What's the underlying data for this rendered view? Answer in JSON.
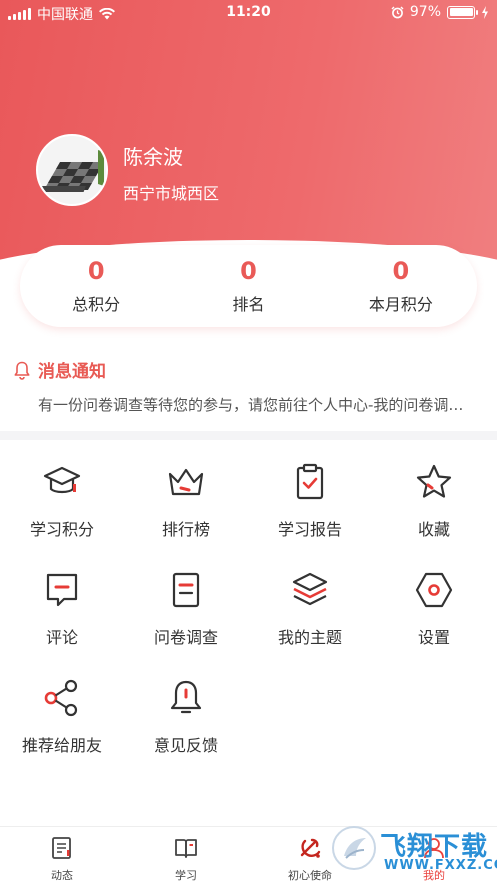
{
  "status_bar": {
    "carrier": "中国联通",
    "time": "11:20",
    "battery": "97%"
  },
  "profile": {
    "name": "陈余波",
    "location": "西宁市城西区"
  },
  "stats": [
    {
      "value": "0",
      "label": "总积分"
    },
    {
      "value": "0",
      "label": "排名"
    },
    {
      "value": "0",
      "label": "本月积分"
    }
  ],
  "notice": {
    "title": "消息通知",
    "text": "有一份问卷调查等待您的参与，请您前往个人中心-我的问卷调查中参与"
  },
  "menu": [
    {
      "label": "学习积分",
      "icon": "graduation-cap-icon"
    },
    {
      "label": "排行榜",
      "icon": "crown-icon"
    },
    {
      "label": "学习报告",
      "icon": "clipboard-check-icon"
    },
    {
      "label": "收藏",
      "icon": "star-icon"
    },
    {
      "label": "评论",
      "icon": "comment-icon"
    },
    {
      "label": "问卷调查",
      "icon": "document-icon"
    },
    {
      "label": "我的主题",
      "icon": "layers-icon"
    },
    {
      "label": "设置",
      "icon": "hexagon-settings-icon"
    },
    {
      "label": "推荐给朋友",
      "icon": "share-icon"
    },
    {
      "label": "意见反馈",
      "icon": "bell-icon"
    }
  ],
  "tabs": [
    {
      "label": "动态",
      "icon": "news-icon"
    },
    {
      "label": "学习",
      "icon": "book-icon"
    },
    {
      "label": "初心使命",
      "icon": "party-emblem-icon"
    },
    {
      "label": "我的",
      "icon": "user-icon",
      "active": true
    }
  ],
  "watermark": {
    "logo": "飞翔下载",
    "url": "WWW.FXXZ.COM"
  },
  "colors": {
    "accent": "#e95a57",
    "header_start": "#e9585a",
    "header_end": "#f07f80"
  }
}
